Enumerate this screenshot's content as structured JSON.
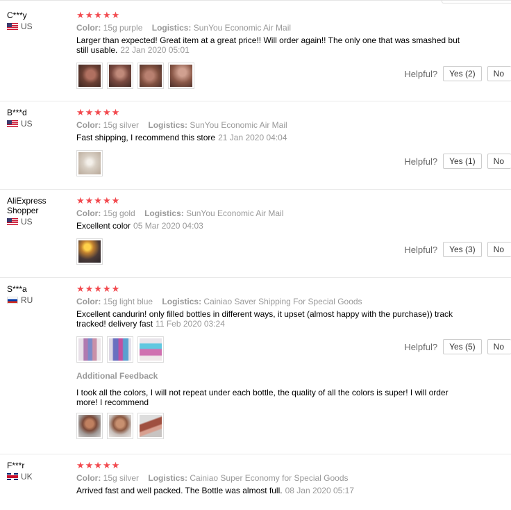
{
  "labels": {
    "color": "Color:",
    "logistics": "Logistics:",
    "helpful": "Helpful?",
    "additional_feedback": "Additional Feedback",
    "no": "No"
  },
  "rating_glyph": "★★★★★",
  "reviews": [
    {
      "name": "C***y",
      "country": "US",
      "flag": "us",
      "color": "15g purple",
      "logistics": "SunYou Economic Air Mail",
      "text": "Larger than expected! Great item at a great price!! Will order again!! The only one that was smashed but still usable.",
      "date": "22 Jan 2020 05:01",
      "yes": "Yes (2)"
    },
    {
      "name": "B***d",
      "country": "US",
      "flag": "us",
      "color": "15g silver",
      "logistics": "SunYou Economic Air Mail",
      "text": "Fast shipping, I recommend this store",
      "date": "21 Jan 2020 04:04",
      "yes": "Yes (1)"
    },
    {
      "name": "AliExpress Shopper",
      "country": "US",
      "flag": "us",
      "color": "15g gold",
      "logistics": "SunYou Economic Air Mail",
      "text": "Excellent color",
      "date": "05 Mar 2020 04:03",
      "yes": "Yes (3)"
    },
    {
      "name": "S***a",
      "country": "RU",
      "flag": "ru",
      "color": "15g light blue",
      "logistics": "Cainiao Saver Shipping For Special Goods",
      "text": "Excellent candurin! only filled bottles in different ways, it upset (almost happy with the purchase)) track tracked! delivery fast",
      "date": "11 Feb 2020 03:24",
      "yes": "Yes (5)",
      "additional_text": "I took all the colors, I will not repeat under each bottle, the quality of all the colors is super! I will order more! I recommend"
    },
    {
      "name": "F***r",
      "country": "UK",
      "flag": "uk",
      "color": "15g silver",
      "logistics": "Cainiao Super Economy for Special Goods",
      "text": "Arrived fast and well packed. The Bottle was almost full.",
      "date": "08 Jan 2020 05:17"
    }
  ]
}
